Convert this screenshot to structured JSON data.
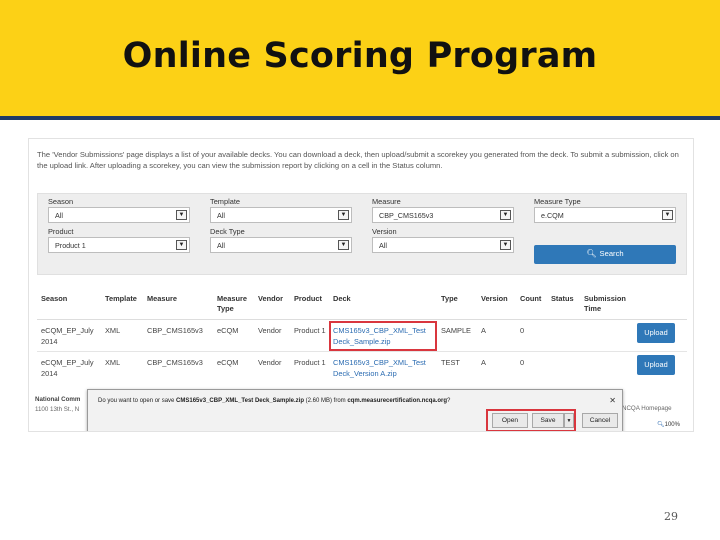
{
  "slide": {
    "title": "Online Scoring Program",
    "page_number": "29",
    "banner_color": "#fcd116"
  },
  "intro_text": "The 'Vendor Submissions' page displays a list of your available decks. You can download a deck, then upload/submit a scorekey you generated from the deck. To submit a submission, click on the upload link. After uploading a scorekey, you can view the submission report by clicking on a cell in the Status column.",
  "filters": {
    "season": {
      "label": "Season",
      "value": "All"
    },
    "template": {
      "label": "Template",
      "value": "All"
    },
    "measure": {
      "label": "Measure",
      "value": "CBP_CMS165v3"
    },
    "measure_type": {
      "label": "Measure Type",
      "value": "e.CQM"
    },
    "product": {
      "label": "Product",
      "value": "Product 1"
    },
    "deck_type": {
      "label": "Deck Type",
      "value": "All"
    },
    "version": {
      "label": "Version",
      "value": "All"
    },
    "search_label": "Search",
    "search_icon": "search-icon"
  },
  "table": {
    "headers": {
      "season": "Season",
      "template": "Template",
      "measure": "Measure",
      "measure_type": "Measure Type",
      "vendor": "Vendor",
      "product": "Product",
      "deck": "Deck",
      "type": "Type",
      "version": "Version",
      "count": "Count",
      "status": "Status",
      "submission_time": "Submission Time"
    },
    "rows": [
      {
        "season": "eCQM_EP_July 2014",
        "template": "XML",
        "measure": "CBP_CMS165v3",
        "measure_type": "eCQM",
        "vendor": "Vendor",
        "product": "Product 1",
        "deck": "CMS165v3_CBP_XML_Test Deck_Sample.zip",
        "type": "SAMPLE",
        "version": "A",
        "count": "0",
        "status": "",
        "submission_time": "",
        "action": "Upload"
      },
      {
        "season": "eCQM_EP_July 2014",
        "template": "XML",
        "measure": "CBP_CMS165v3",
        "measure_type": "eCQM",
        "vendor": "Vendor",
        "product": "Product 1",
        "deck": "CMS165v3_CBP_XML_Test Deck_Version A.zip",
        "type": "TEST",
        "version": "A",
        "count": "0",
        "status": "",
        "submission_time": "",
        "action": "Upload"
      }
    ]
  },
  "footer": {
    "org": "National Comm",
    "address": "1100 13th St., N",
    "link": "NCQA Homepage"
  },
  "download_dialog": {
    "message_prefix": "Do you want to open or save ",
    "file_name": "CMS165v3_CBP_XML_Test Deck_Sample.zip",
    "size": " (2.60 MB) from ",
    "host": "cqm.measurecertification.ncqa.org",
    "message_suffix": "?",
    "open_label": "Open",
    "save_label": "Save",
    "save_dropdown_icon": "chevron-down-icon",
    "cancel_label": "Cancel",
    "close_icon": "close-icon"
  },
  "browser": {
    "zoom": "100%",
    "zoom_icon": "zoom-icon"
  },
  "colors": {
    "accent": "#2f78b8",
    "highlight": "#d9363e",
    "rule": "#1f3a66"
  }
}
